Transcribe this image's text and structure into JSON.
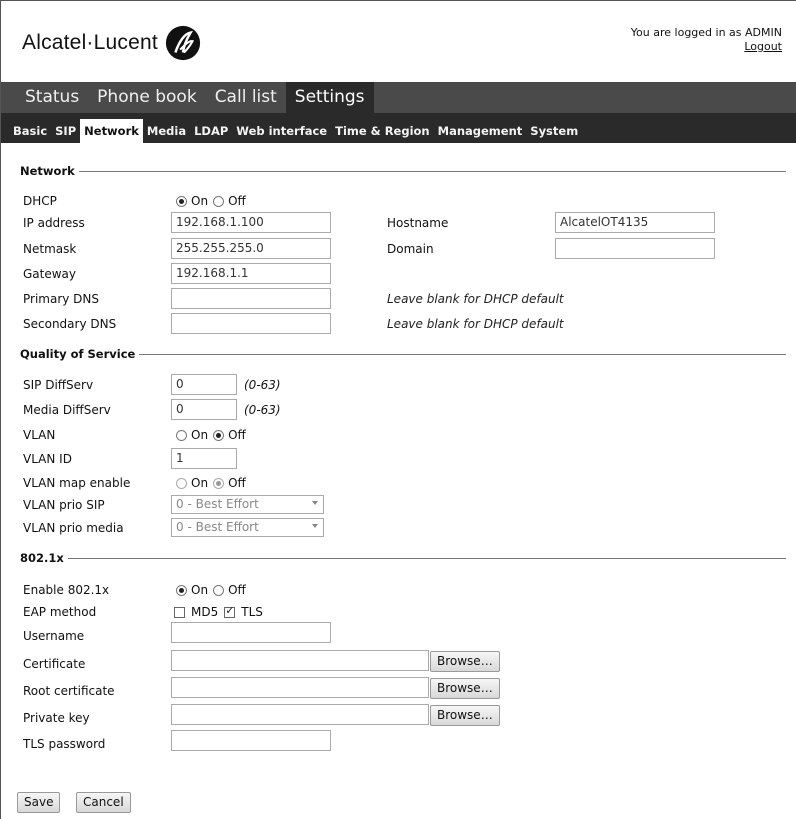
{
  "header": {
    "brand": "Alcatel·Lucent",
    "logged_in_text": "You are logged in as ADMIN",
    "logout_label": "Logout"
  },
  "main_nav": [
    "Status",
    "Phone book",
    "Call list",
    "Settings"
  ],
  "sub_nav": [
    "Basic",
    "SIP",
    "Network",
    "Media",
    "LDAP",
    "Web interface",
    "Time & Region",
    "Management",
    "System"
  ],
  "network": {
    "title": "Network",
    "dhcp_label": "DHCP",
    "on_label": "On",
    "off_label": "Off",
    "ip_label": "IP address",
    "ip_value": "192.168.1.100",
    "hostname_label": "Hostname",
    "hostname_value": "AlcatelOT4135",
    "netmask_label": "Netmask",
    "netmask_value": "255.255.255.0",
    "domain_label": "Domain",
    "domain_value": "",
    "gateway_label": "Gateway",
    "gateway_value": "192.168.1.1",
    "primary_dns_label": "Primary DNS",
    "primary_dns_value": "",
    "secondary_dns_label": "Secondary DNS",
    "secondary_dns_value": "",
    "dns_hint": "Leave blank for DHCP default"
  },
  "qos": {
    "title": "Quality of Service",
    "sip_diffserv_label": "SIP DiffServ",
    "sip_diffserv_value": "0",
    "media_diffserv_label": "Media DiffServ",
    "media_diffserv_value": "0",
    "range_hint": "(0-63)",
    "vlan_label": "VLAN",
    "vlan_id_label": "VLAN ID",
    "vlan_id_value": "1",
    "vlan_map_label": "VLAN map enable",
    "vlan_prio_sip_label": "VLAN prio SIP",
    "vlan_prio_sip_value": "0 - Best Effort",
    "vlan_prio_media_label": "VLAN prio media",
    "vlan_prio_media_value": "0 - Best Effort"
  },
  "dot1x": {
    "title": "802.1x",
    "enable_label": "Enable 802.1x",
    "eap_label": "EAP method",
    "md5_label": "MD5",
    "tls_label": "TLS",
    "username_label": "Username",
    "certificate_label": "Certificate",
    "root_certificate_label": "Root certificate",
    "private_key_label": "Private key",
    "tls_password_label": "TLS password",
    "browse_label": "Browse…"
  },
  "actions": {
    "save_label": "Save",
    "cancel_label": "Cancel"
  },
  "state": {
    "dhcp": "On",
    "vlan": "Off",
    "vlan_map": "Off",
    "enable_8021x": "On",
    "md5_checked": false,
    "tls_checked": true
  }
}
